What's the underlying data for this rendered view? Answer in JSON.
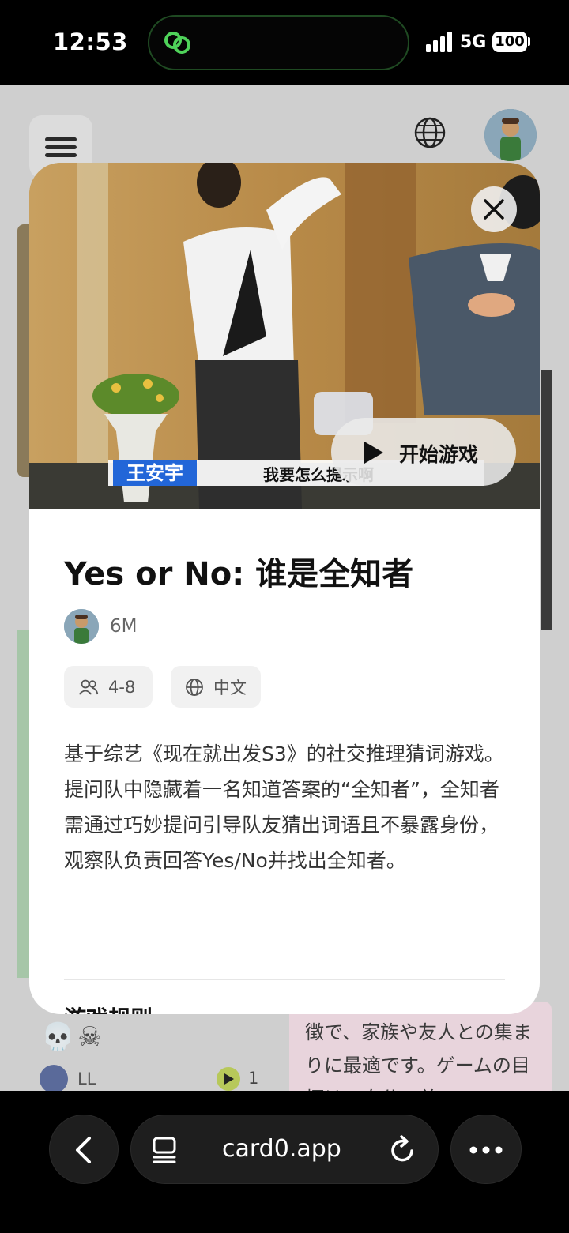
{
  "status_bar": {
    "time": "12:53",
    "network": "5G",
    "battery": "100",
    "island_icon": "link-rings-icon"
  },
  "background_page": {
    "japanese_text": "徴で、家族や友人との集まりに最適です。ゲームの目標は、自分の義の",
    "skulls": "💀☠",
    "user_name": "LL",
    "play_count": "1"
  },
  "modal": {
    "hero": {
      "subtitle_name": "王安宇",
      "subtitle_text": "我要怎么提示啊",
      "start_button_label": "开始游戏"
    },
    "title": "Yes or No: 谁是全知者",
    "author": "6M",
    "players_chip": "4-8",
    "language_chip": "中文",
    "description": "基于综艺《现在就出发S3》的社交推理猜词游戏。提问队中隐藏着一名知道答案的“全知者”，全知者需通过巧妙提问引导队友猜出词语且不暴露身份，观察队负责回答Yes/No并找出全知者。",
    "rules_heading": "游戏规则"
  },
  "browser_bar": {
    "url": "card0.app"
  },
  "colors": {
    "modal_bg": "#ffffff",
    "chip_bg": "#f1f1f1",
    "subtitle_name_bg": "#2266d8",
    "island_border": "#1f4a22"
  }
}
